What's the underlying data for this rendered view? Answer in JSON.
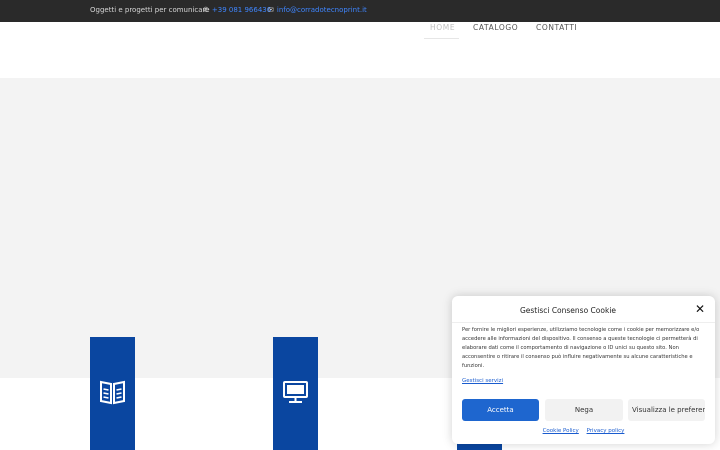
{
  "topbar": {
    "tagline": "Oggetti e progetti per comunicare",
    "phone": "+39 081 966436",
    "email": "info@corradotecnoprint.it"
  },
  "nav": {
    "items": [
      {
        "label": "HOME",
        "active": true
      },
      {
        "label": "CATALOGO",
        "active": false
      },
      {
        "label": "CONTATTI",
        "active": false
      }
    ]
  },
  "features": {
    "icons": [
      "book-icon",
      "monitor-icon"
    ]
  },
  "cookie": {
    "title": "Gestisci Consenso Cookie",
    "body": "Per fornire le migliori esperienze, utilizziamo tecnologie come i cookie per memorizzare e/o accedere alle informazioni del dispositivo. Il consenso a queste tecnologie ci permetterà di elaborare dati come il comportamento di navigazione o ID unici su questo sito. Non acconsentire o ritirare il consenso può influire negativamente su alcune caratteristiche e funzioni.",
    "manage_link": "Gestisci servizi",
    "accept": "Accetta",
    "deny": "Nega",
    "preferences": "Visualizza le preferenze",
    "cookie_policy": "Cookie Policy",
    "privacy_policy": "Privacy policy"
  },
  "colors": {
    "topbar_bg": "#2a2a2a",
    "link": "#3f86ff",
    "feature_blue": "#0a46a0",
    "accept_blue": "#1e66cf"
  }
}
